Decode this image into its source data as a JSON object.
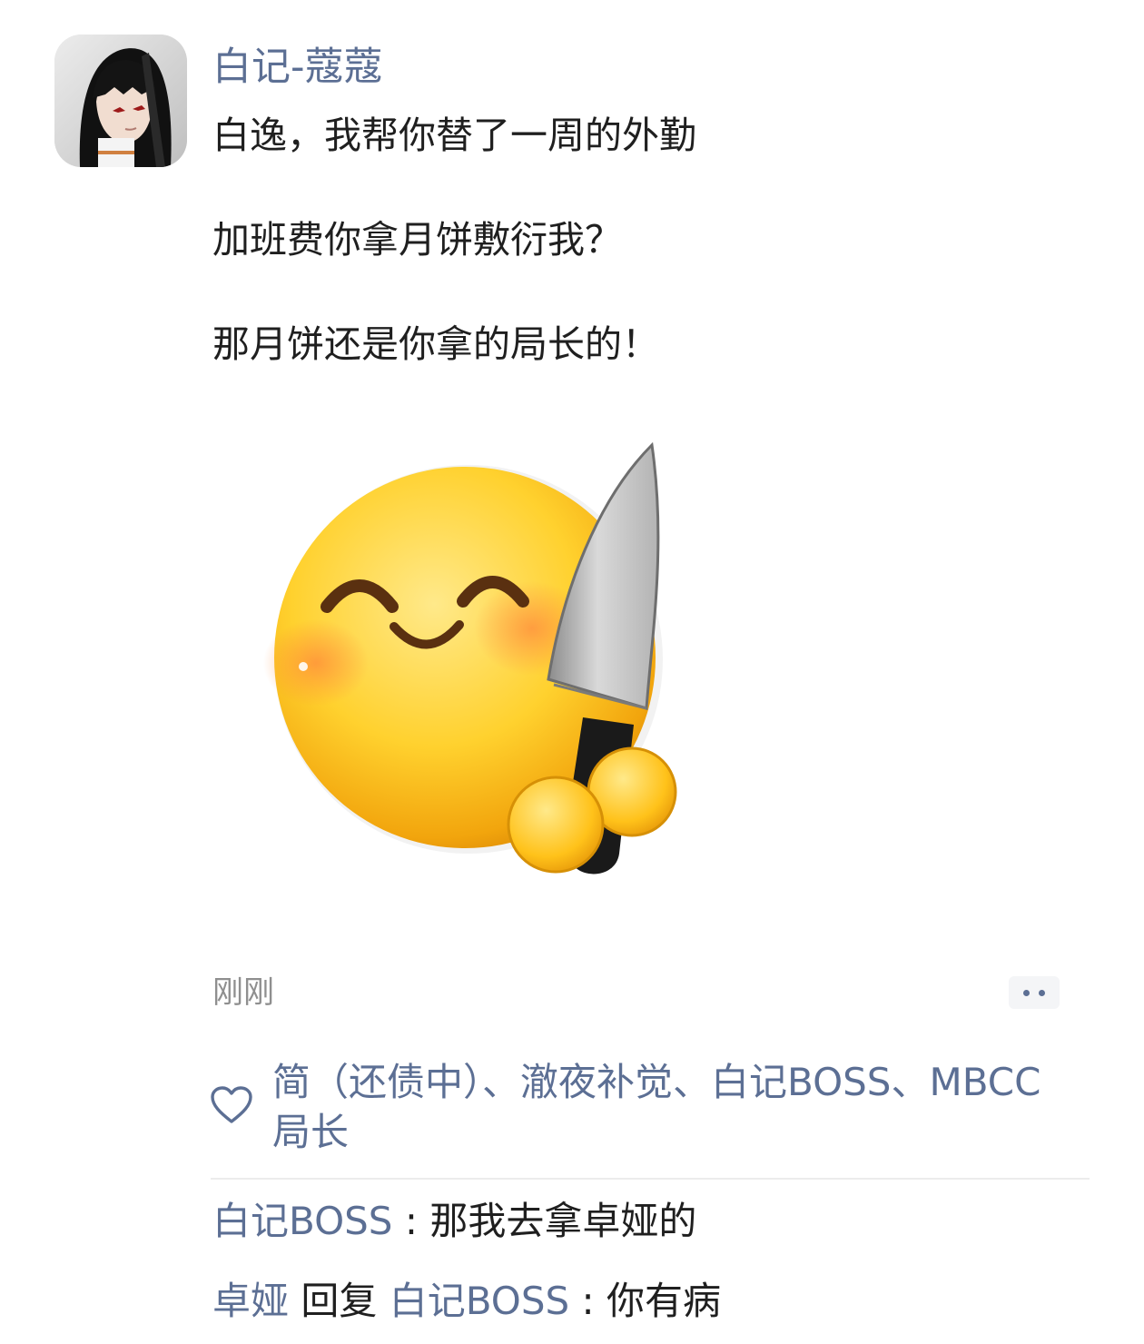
{
  "post": {
    "author": "白记-蔻蔻",
    "lines": [
      "白逸，我帮你替了一周的外勤",
      "加班费你拿月饼敷衍我？",
      "那月饼还是你拿的局长的！"
    ],
    "sticker_icon": "smiling-face-with-knife-sticker",
    "timestamp": "刚刚",
    "more_icon": "more-dots-icon"
  },
  "likes": {
    "icon": "heart-icon",
    "names": "简（还债中）、澈夜补觉、白记BOSS、MBCC局长"
  },
  "comments": [
    {
      "author": "白记BOSS",
      "separator": " : ",
      "text": "那我去拿卓娅的"
    },
    {
      "author": "卓娅",
      "reply_word": " 回复 ",
      "reply_to": "白记BOSS",
      "separator": " : ",
      "text": "你有病"
    }
  ],
  "colors": {
    "link": "#5c6f94",
    "text": "#1f1f1f",
    "timestamp": "#8f8f8f",
    "divider": "#ececec",
    "background": "#ffffff"
  }
}
